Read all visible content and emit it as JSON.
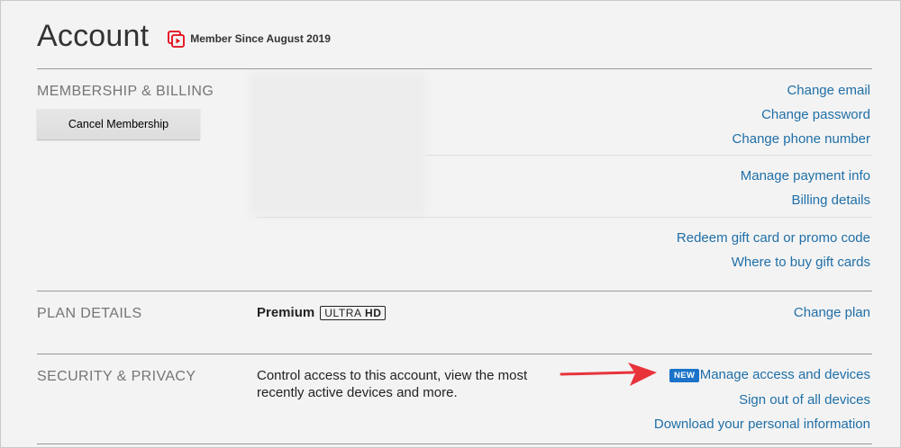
{
  "header": {
    "title": "Account",
    "member_since": "Member Since August 2019"
  },
  "membership": {
    "section_title": "MEMBERSHIP & BILLING",
    "cancel_label": "Cancel Membership",
    "links": {
      "change_email": "Change email",
      "change_password": "Change password",
      "change_phone": "Change phone number",
      "manage_payment": "Manage payment info",
      "billing_details": "Billing details",
      "redeem_gift": "Redeem gift card or promo code",
      "where_buy": "Where to buy gift cards"
    }
  },
  "plan": {
    "section_title": "PLAN DETAILS",
    "plan_name": "Premium",
    "badge_part1": "ULTRA",
    "badge_part2": "HD",
    "change_plan": "Change plan"
  },
  "security": {
    "section_title": "SECURITY & PRIVACY",
    "description": "Control access to this account, view the most recently active devices and more.",
    "new_badge": "NEW",
    "manage_access": "Manage access and devices",
    "sign_out": "Sign out of all devices",
    "download_info": "Download your personal information"
  },
  "colors": {
    "link": "#1f6fa8",
    "badge": "#1a73c9",
    "arrow": "#e8333b",
    "member_icon": "#e50914"
  }
}
